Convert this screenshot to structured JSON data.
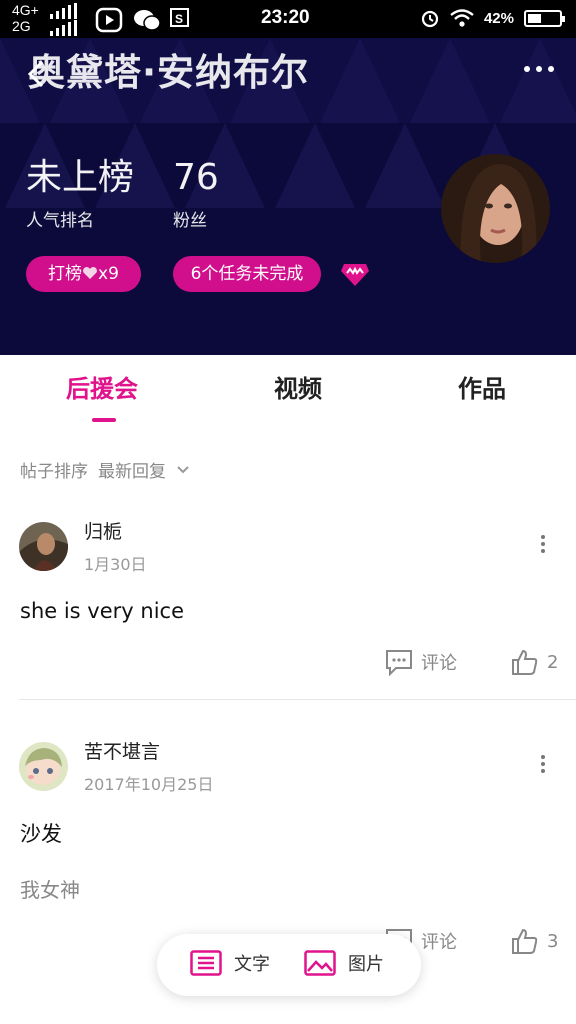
{
  "status_bar": {
    "network_top": "4G+",
    "network_bottom": "2G",
    "time": "23:20",
    "battery": "42%",
    "battery_level": 0.42
  },
  "header": {
    "title": "奥黛塔·安纳布尔",
    "rank_value": "未上榜",
    "rank_label": "人气排名",
    "fans_value": "76",
    "fans_label": "粉丝",
    "rank_button": "打榜",
    "rank_button_suffix": "x9",
    "task_button": "6个任务未完成",
    "colors": {
      "background": "#0c0a3a",
      "accent": "#d10f8c"
    }
  },
  "tabs": [
    {
      "label": "后援会",
      "active": true
    },
    {
      "label": "视频",
      "active": false
    },
    {
      "label": "作品",
      "active": false
    }
  ],
  "sort": {
    "label": "帖子排序",
    "value": "最新回复"
  },
  "posts": [
    {
      "user": "归栀",
      "date": "1月30日",
      "text": "she is very nice",
      "text2": "",
      "comment_label": "评论",
      "likes": "2"
    },
    {
      "user": "苦不堪言",
      "date": "2017年10月25日",
      "text": "沙发",
      "text2": "我女神",
      "comment_label": "评论",
      "likes": "3"
    }
  ],
  "compose": {
    "text_label": "文字",
    "image_label": "图片"
  },
  "icons": [
    "back-icon",
    "more-icon",
    "heart-icon",
    "gem-icon",
    "chevron-down-icon",
    "comment-icon",
    "thumbs-up-icon",
    "text-icon",
    "image-icon",
    "wifi-icon",
    "alarm-icon"
  ]
}
